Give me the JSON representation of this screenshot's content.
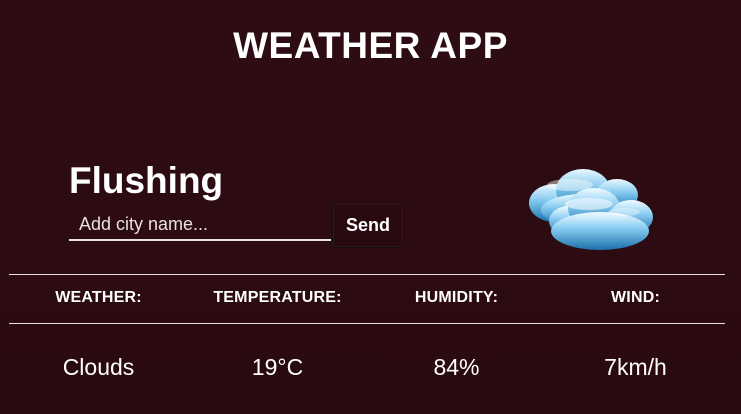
{
  "app": {
    "title": "WEATHER APP"
  },
  "location": {
    "city": "Flushing"
  },
  "search": {
    "placeholder": "Add city name...",
    "send_label": "Send"
  },
  "weather_icon": "cloud-icon",
  "details": {
    "headers": [
      "WEATHER:",
      "TEMPERATURE:",
      "HUMIDITY:",
      "WIND:"
    ],
    "values": [
      "Clouds",
      "19°C",
      "84%",
      "7km/h"
    ]
  },
  "colors": {
    "background": "#2e0b12",
    "text": "#ffffff",
    "cloud_light": "#dff3ff",
    "cloud_mid": "#6fbde8",
    "cloud_dark": "#1a79b3"
  }
}
